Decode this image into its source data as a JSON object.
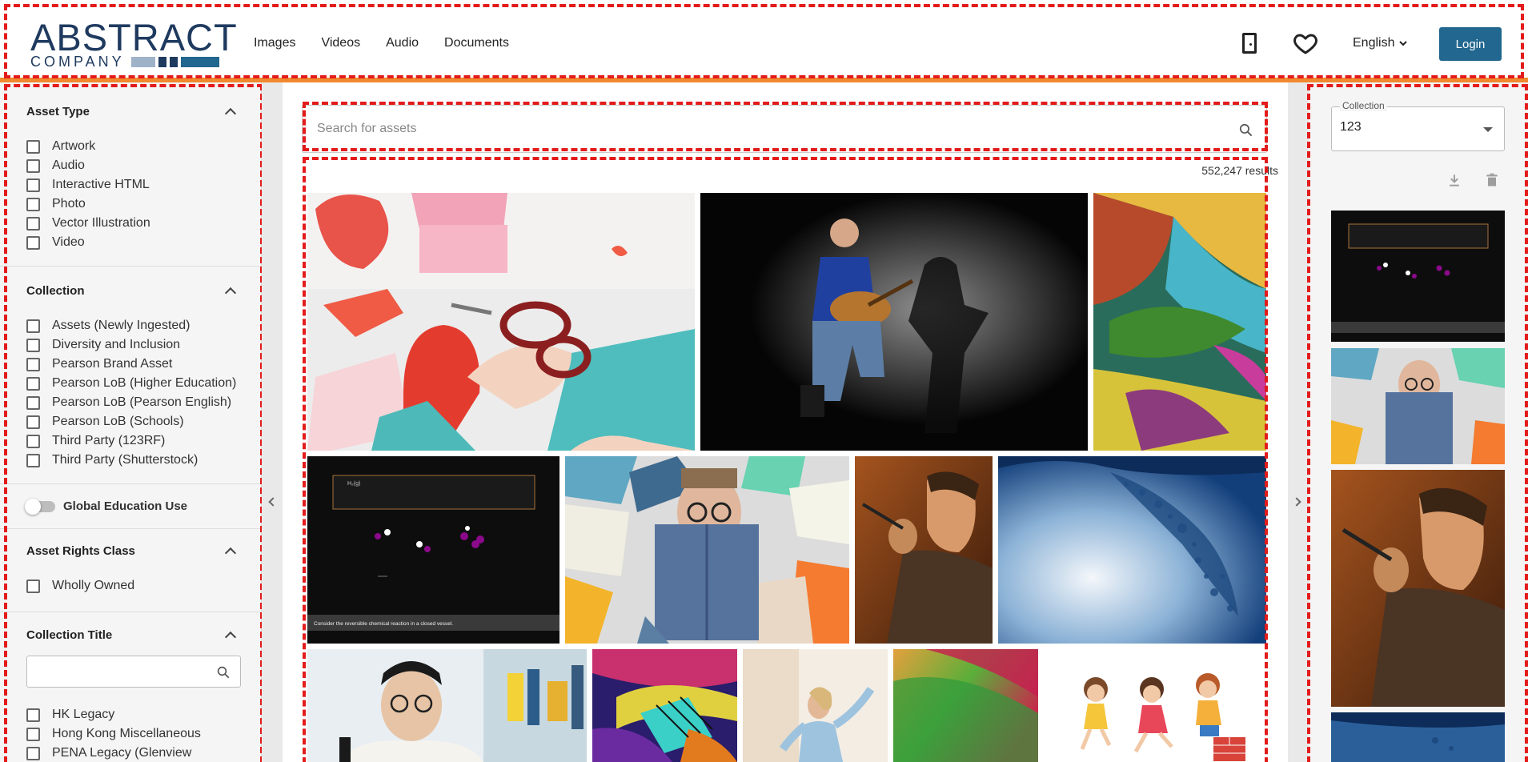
{
  "header": {
    "logo_top": "ABSTRACT",
    "logo_bottom": "COMPANY",
    "nav": [
      "Images",
      "Videos",
      "Audio",
      "Documents"
    ],
    "language": "English",
    "login_label": "Login",
    "accent_color": "#f0892f",
    "brand_color": "#21678f"
  },
  "sidebar": {
    "asset_type": {
      "title": "Asset Type",
      "options": [
        "Artwork",
        "Audio",
        "Interactive HTML",
        "Photo",
        "Vector Illustration",
        "Video"
      ]
    },
    "collection": {
      "title": "Collection",
      "options": [
        "Assets (Newly Ingested)",
        "Diversity and Inclusion",
        "Pearson Brand Asset",
        "Pearson LoB (Higher Education)",
        "Pearson LoB (Pearson English)",
        "Pearson LoB (Schools)",
        "Third Party (123RF)",
        "Third Party (Shutterstock)"
      ]
    },
    "global_education": {
      "label": "Global Education Use",
      "enabled": false
    },
    "asset_rights": {
      "title": "Asset Rights Class",
      "options": [
        "Wholly Owned"
      ]
    },
    "collection_title": {
      "title": "Collection Title",
      "search_placeholder": "",
      "options": [
        "HK Legacy",
        "Hong Kong Miscellaneous",
        "PENA Legacy (Glenview"
      ]
    }
  },
  "main": {
    "search_placeholder": "Search for assets",
    "results_count": "552,247 results",
    "tiles": [
      {
        "subject": "hands cutting paper heart with scissors"
      },
      {
        "subject": "man playing guitar with shadow"
      },
      {
        "subject": "colorful crystal micrograph"
      },
      {
        "subject": "chemistry reaction animation",
        "caption": "Consider the reversible chemical reaction in a closed vessel.",
        "box_text": "H₂(g)"
      },
      {
        "subject": "man hiding behind book among books"
      },
      {
        "subject": "man throwing dart"
      },
      {
        "subject": "bubbles in water"
      },
      {
        "subject": "smiling student in library"
      },
      {
        "subject": "crystal micrograph"
      },
      {
        "subject": "girl dancing"
      },
      {
        "subject": "green and red abstract"
      },
      {
        "subject": "children running cartoon"
      }
    ]
  },
  "right_panel": {
    "collection_label": "Collection",
    "collection_value": "123",
    "thumbs": [
      "chemistry reaction animation",
      "man hiding behind book",
      "man throwing dart",
      "bubbles in water"
    ]
  }
}
